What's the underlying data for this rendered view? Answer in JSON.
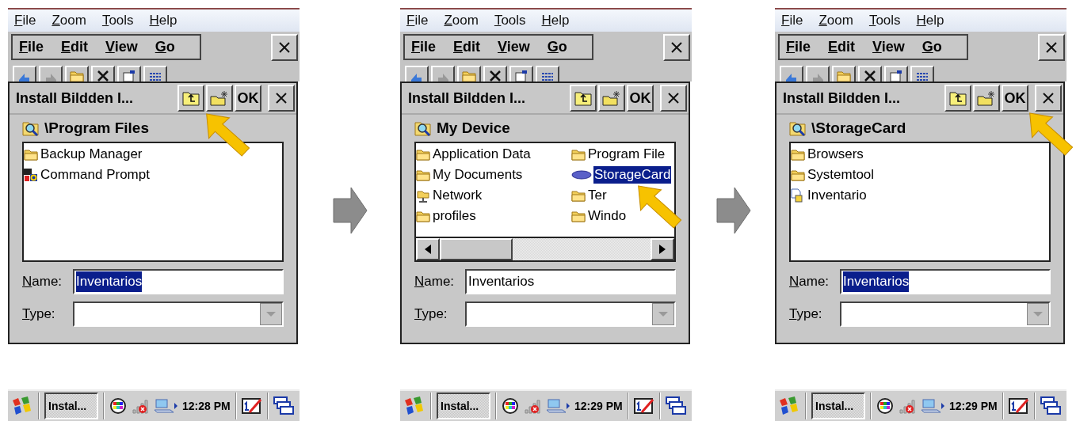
{
  "screens": [
    {
      "menu": [
        "File",
        "Zoom",
        "Tools",
        "Help"
      ],
      "app_menu": [
        "File",
        "Edit",
        "View",
        "Go"
      ],
      "dialog": {
        "title": "Install Bildden I...",
        "ok": "OK",
        "location": "\\Program Files",
        "scrollbar": false,
        "files": [
          {
            "name": "Backup Manager",
            "kind": "folder",
            "selected": false
          },
          {
            "name": "Command Prompt",
            "kind": "program",
            "selected": false
          }
        ],
        "name_label": "Name:",
        "name_value": "Inventarios",
        "name_value_selected": true,
        "type_label": "Type:"
      },
      "taskbar": {
        "task": "Instal...",
        "time": "12:28 PM"
      }
    },
    {
      "menu": [
        "File",
        "Zoom",
        "Tools",
        "Help"
      ],
      "app_menu": [
        "File",
        "Edit",
        "View",
        "Go"
      ],
      "dialog": {
        "title": "Install Bildden I...",
        "ok": "OK",
        "location": "My Device",
        "scrollbar": true,
        "files": [
          {
            "name": "Application Data",
            "kind": "folder",
            "selected": false
          },
          {
            "name": "My Documents",
            "kind": "folder",
            "selected": false
          },
          {
            "name": "Network",
            "kind": "network",
            "selected": false
          },
          {
            "name": "profiles",
            "kind": "folder",
            "selected": false
          },
          {
            "name": "Program File",
            "kind": "folder",
            "selected": false
          },
          {
            "name": "StorageCard",
            "kind": "storage",
            "selected": true
          },
          {
            "name": "Ter",
            "kind": "folder",
            "selected": false
          },
          {
            "name": "Windo",
            "kind": "folder",
            "selected": false
          }
        ],
        "name_label": "Name:",
        "name_value": "Inventarios",
        "name_value_selected": false,
        "type_label": "Type:"
      },
      "taskbar": {
        "task": "Instal...",
        "time": "12:29 PM"
      }
    },
    {
      "menu": [
        "File",
        "Zoom",
        "Tools",
        "Help"
      ],
      "app_menu": [
        "File",
        "Edit",
        "View",
        "Go"
      ],
      "dialog": {
        "title": "Install Bildden I...",
        "ok": "OK",
        "location": "\\StorageCard",
        "scrollbar": false,
        "files": [
          {
            "name": "Browsers",
            "kind": "folder",
            "selected": false
          },
          {
            "name": "Systemtool",
            "kind": "folder",
            "selected": false
          },
          {
            "name": "Inventario",
            "kind": "setup",
            "selected": false
          }
        ],
        "name_label": "Name:",
        "name_value": "Inventarios",
        "name_value_selected": true,
        "type_label": "Type:"
      },
      "taskbar": {
        "task": "Instal...",
        "time": "12:29 PM"
      }
    }
  ]
}
